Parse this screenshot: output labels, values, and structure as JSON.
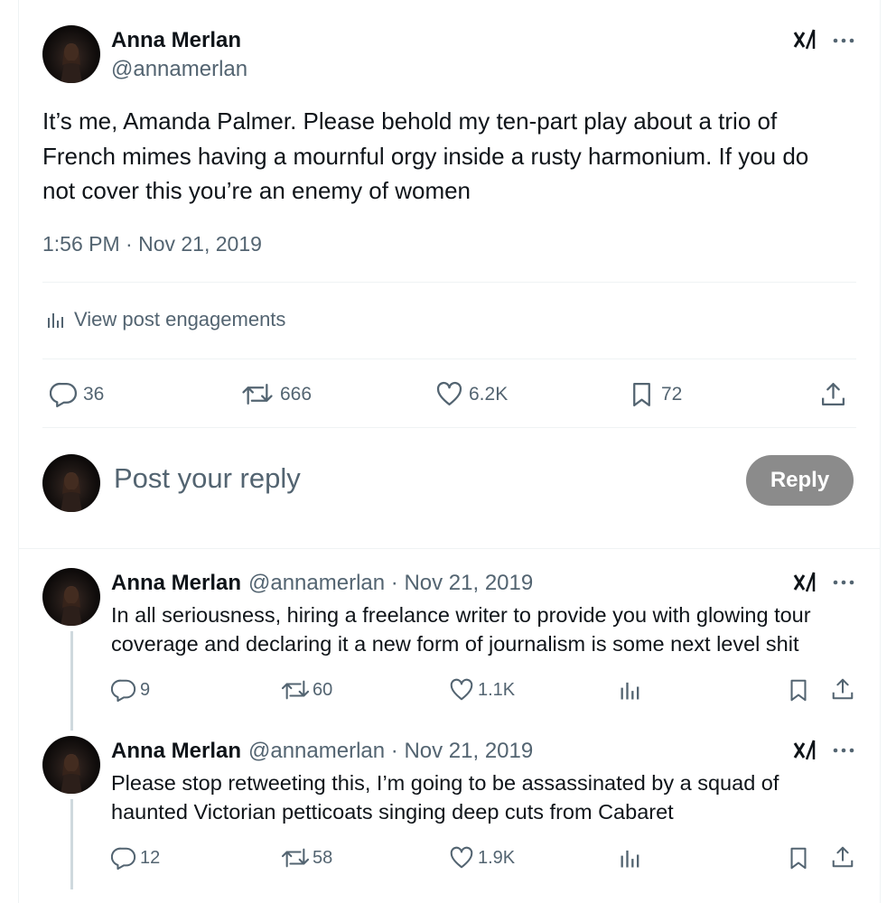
{
  "main_tweet": {
    "author_name": "Anna Merlan",
    "author_handle": "@annamerlan",
    "text": "It’s me, Amanda Palmer. Please behold my ten-part play about a trio of French mimes having a mournful orgy inside a rusty harmonium. If you do not cover this you’re an enemy of women",
    "timestamp": "1:56 PM · Nov 21, 2019",
    "engagements_label": "View post engagements",
    "replies": "36",
    "reposts": "666",
    "likes": "6.2K",
    "bookmarks": "72"
  },
  "composer": {
    "placeholder": "Post your reply",
    "reply_label": "Reply"
  },
  "replies": [
    {
      "author_name": "Anna Merlan",
      "handle_date": "@annamerlan · Nov 21, 2019",
      "text": "In all seriousness, hiring a freelance writer to provide you with glowing tour coverage and declaring it a new form of journalism is some next level shit",
      "replies": "9",
      "reposts": "60",
      "likes": "1.1K"
    },
    {
      "author_name": "Anna Merlan",
      "handle_date": "@annamerlan · Nov 21, 2019",
      "text": "Please stop retweeting this, I’m going to be assassinated by a squad of haunted Victorian petticoats singing deep cuts from Cabaret",
      "replies": "12",
      "reposts": "58",
      "likes": "1.9K"
    }
  ],
  "icons": {
    "grok": "grok-icon",
    "more": "more-icon",
    "reply": "reply-icon",
    "repost": "repost-icon",
    "like": "heart-icon",
    "bookmark": "bookmark-icon",
    "share": "share-icon",
    "analytics": "analytics-icon"
  },
  "colors": {
    "text": "#0f1419",
    "muted": "#536471",
    "divider": "#eff3f4",
    "reply_button": "#8b8b8b"
  }
}
